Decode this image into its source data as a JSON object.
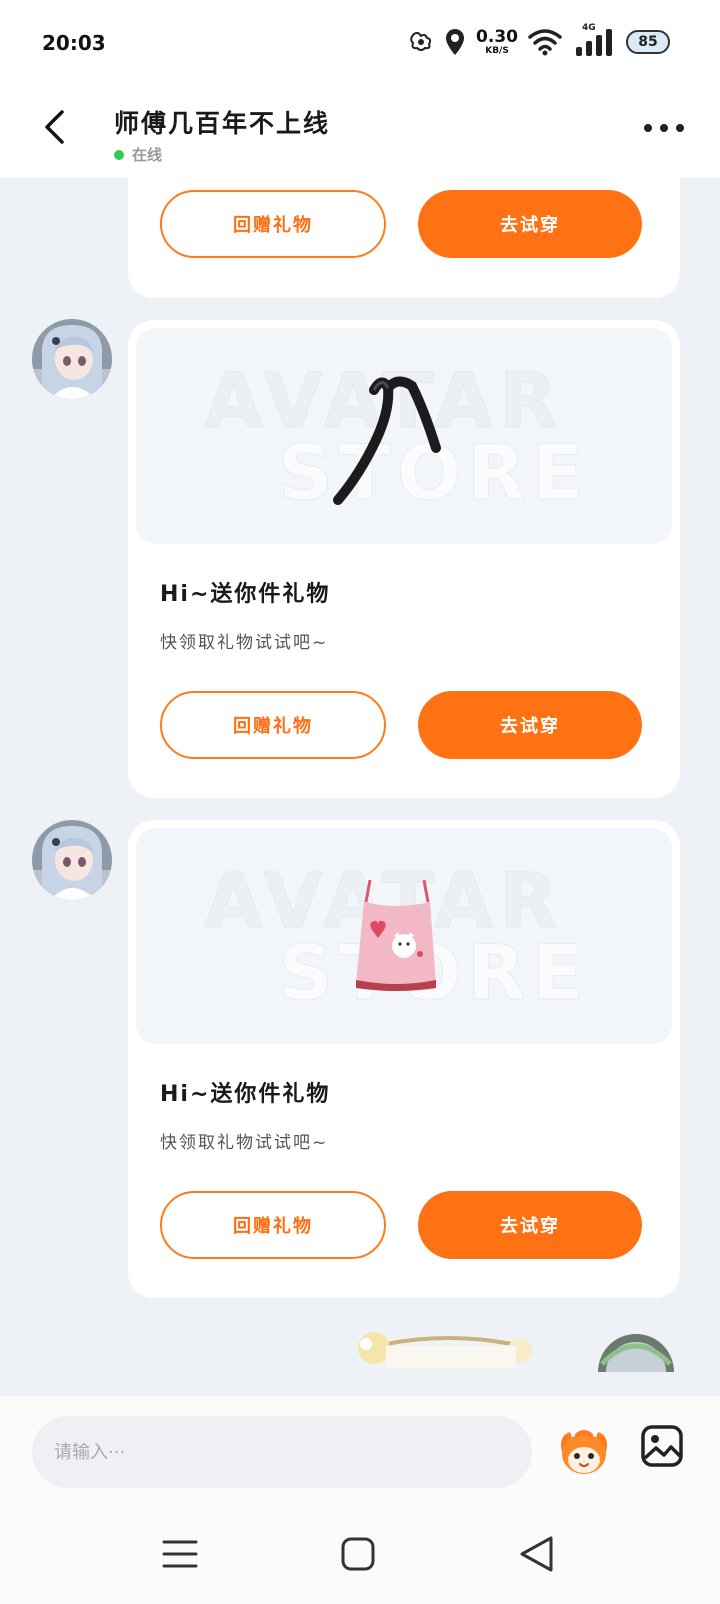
{
  "status_bar": {
    "time": "20:03",
    "net_speed": "0.30",
    "net_unit": "KB/S",
    "signal_label": "4G",
    "battery": "85"
  },
  "header": {
    "title": "师傅几百年不上线",
    "status": "在线"
  },
  "watermark": {
    "line1": "AVATAR",
    "line2": "STORE"
  },
  "cards": [
    {
      "return_gift_label": "回赠礼物",
      "try_on_label": "去试穿"
    },
    {
      "title": "Hi~送你件礼物",
      "subtitle": "快领取礼物试试吧~",
      "item_icon": "black-ribbon-icon",
      "return_gift_label": "回赠礼物",
      "try_on_label": "去试穿"
    },
    {
      "title": "Hi~送你件礼物",
      "subtitle": "快领取礼物试试吧~",
      "item_icon": "pink-camisole-icon",
      "return_gift_label": "回赠礼物",
      "try_on_label": "去试穿"
    }
  ],
  "input": {
    "placeholder": "请输入···"
  },
  "colors": {
    "accent": "#ff7214",
    "online": "#2ecc54",
    "background": "#eef2f7"
  }
}
